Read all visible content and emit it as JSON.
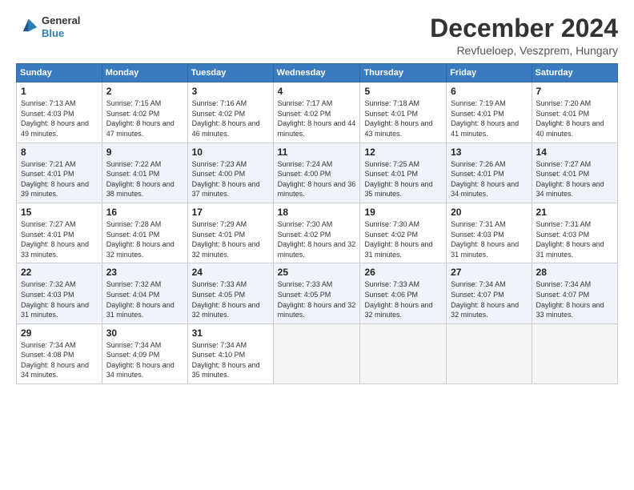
{
  "logo": {
    "line1": "General",
    "line2": "Blue"
  },
  "title": "December 2024",
  "location": "Revfueloep, Veszprem, Hungary",
  "weekdays": [
    "Sunday",
    "Monday",
    "Tuesday",
    "Wednesday",
    "Thursday",
    "Friday",
    "Saturday"
  ],
  "weeks": [
    [
      {
        "day": "1",
        "sunrise": "7:13 AM",
        "sunset": "4:03 PM",
        "daylight": "8 hours and 49 minutes."
      },
      {
        "day": "2",
        "sunrise": "7:15 AM",
        "sunset": "4:02 PM",
        "daylight": "8 hours and 47 minutes."
      },
      {
        "day": "3",
        "sunrise": "7:16 AM",
        "sunset": "4:02 PM",
        "daylight": "8 hours and 46 minutes."
      },
      {
        "day": "4",
        "sunrise": "7:17 AM",
        "sunset": "4:02 PM",
        "daylight": "8 hours and 44 minutes."
      },
      {
        "day": "5",
        "sunrise": "7:18 AM",
        "sunset": "4:01 PM",
        "daylight": "8 hours and 43 minutes."
      },
      {
        "day": "6",
        "sunrise": "7:19 AM",
        "sunset": "4:01 PM",
        "daylight": "8 hours and 41 minutes."
      },
      {
        "day": "7",
        "sunrise": "7:20 AM",
        "sunset": "4:01 PM",
        "daylight": "8 hours and 40 minutes."
      }
    ],
    [
      {
        "day": "8",
        "sunrise": "7:21 AM",
        "sunset": "4:01 PM",
        "daylight": "8 hours and 39 minutes."
      },
      {
        "day": "9",
        "sunrise": "7:22 AM",
        "sunset": "4:01 PM",
        "daylight": "8 hours and 38 minutes."
      },
      {
        "day": "10",
        "sunrise": "7:23 AM",
        "sunset": "4:00 PM",
        "daylight": "8 hours and 37 minutes."
      },
      {
        "day": "11",
        "sunrise": "7:24 AM",
        "sunset": "4:00 PM",
        "daylight": "8 hours and 36 minutes."
      },
      {
        "day": "12",
        "sunrise": "7:25 AM",
        "sunset": "4:01 PM",
        "daylight": "8 hours and 35 minutes."
      },
      {
        "day": "13",
        "sunrise": "7:26 AM",
        "sunset": "4:01 PM",
        "daylight": "8 hours and 34 minutes."
      },
      {
        "day": "14",
        "sunrise": "7:27 AM",
        "sunset": "4:01 PM",
        "daylight": "8 hours and 34 minutes."
      }
    ],
    [
      {
        "day": "15",
        "sunrise": "7:27 AM",
        "sunset": "4:01 PM",
        "daylight": "8 hours and 33 minutes."
      },
      {
        "day": "16",
        "sunrise": "7:28 AM",
        "sunset": "4:01 PM",
        "daylight": "8 hours and 32 minutes."
      },
      {
        "day": "17",
        "sunrise": "7:29 AM",
        "sunset": "4:01 PM",
        "daylight": "8 hours and 32 minutes."
      },
      {
        "day": "18",
        "sunrise": "7:30 AM",
        "sunset": "4:02 PM",
        "daylight": "8 hours and 32 minutes."
      },
      {
        "day": "19",
        "sunrise": "7:30 AM",
        "sunset": "4:02 PM",
        "daylight": "8 hours and 31 minutes."
      },
      {
        "day": "20",
        "sunrise": "7:31 AM",
        "sunset": "4:03 PM",
        "daylight": "8 hours and 31 minutes."
      },
      {
        "day": "21",
        "sunrise": "7:31 AM",
        "sunset": "4:03 PM",
        "daylight": "8 hours and 31 minutes."
      }
    ],
    [
      {
        "day": "22",
        "sunrise": "7:32 AM",
        "sunset": "4:03 PM",
        "daylight": "8 hours and 31 minutes."
      },
      {
        "day": "23",
        "sunrise": "7:32 AM",
        "sunset": "4:04 PM",
        "daylight": "8 hours and 31 minutes."
      },
      {
        "day": "24",
        "sunrise": "7:33 AM",
        "sunset": "4:05 PM",
        "daylight": "8 hours and 32 minutes."
      },
      {
        "day": "25",
        "sunrise": "7:33 AM",
        "sunset": "4:05 PM",
        "daylight": "8 hours and 32 minutes."
      },
      {
        "day": "26",
        "sunrise": "7:33 AM",
        "sunset": "4:06 PM",
        "daylight": "8 hours and 32 minutes."
      },
      {
        "day": "27",
        "sunrise": "7:34 AM",
        "sunset": "4:07 PM",
        "daylight": "8 hours and 32 minutes."
      },
      {
        "day": "28",
        "sunrise": "7:34 AM",
        "sunset": "4:07 PM",
        "daylight": "8 hours and 33 minutes."
      }
    ],
    [
      {
        "day": "29",
        "sunrise": "7:34 AM",
        "sunset": "4:08 PM",
        "daylight": "8 hours and 34 minutes."
      },
      {
        "day": "30",
        "sunrise": "7:34 AM",
        "sunset": "4:09 PM",
        "daylight": "8 hours and 34 minutes."
      },
      {
        "day": "31",
        "sunrise": "7:34 AM",
        "sunset": "4:10 PM",
        "daylight": "8 hours and 35 minutes."
      },
      null,
      null,
      null,
      null
    ]
  ]
}
